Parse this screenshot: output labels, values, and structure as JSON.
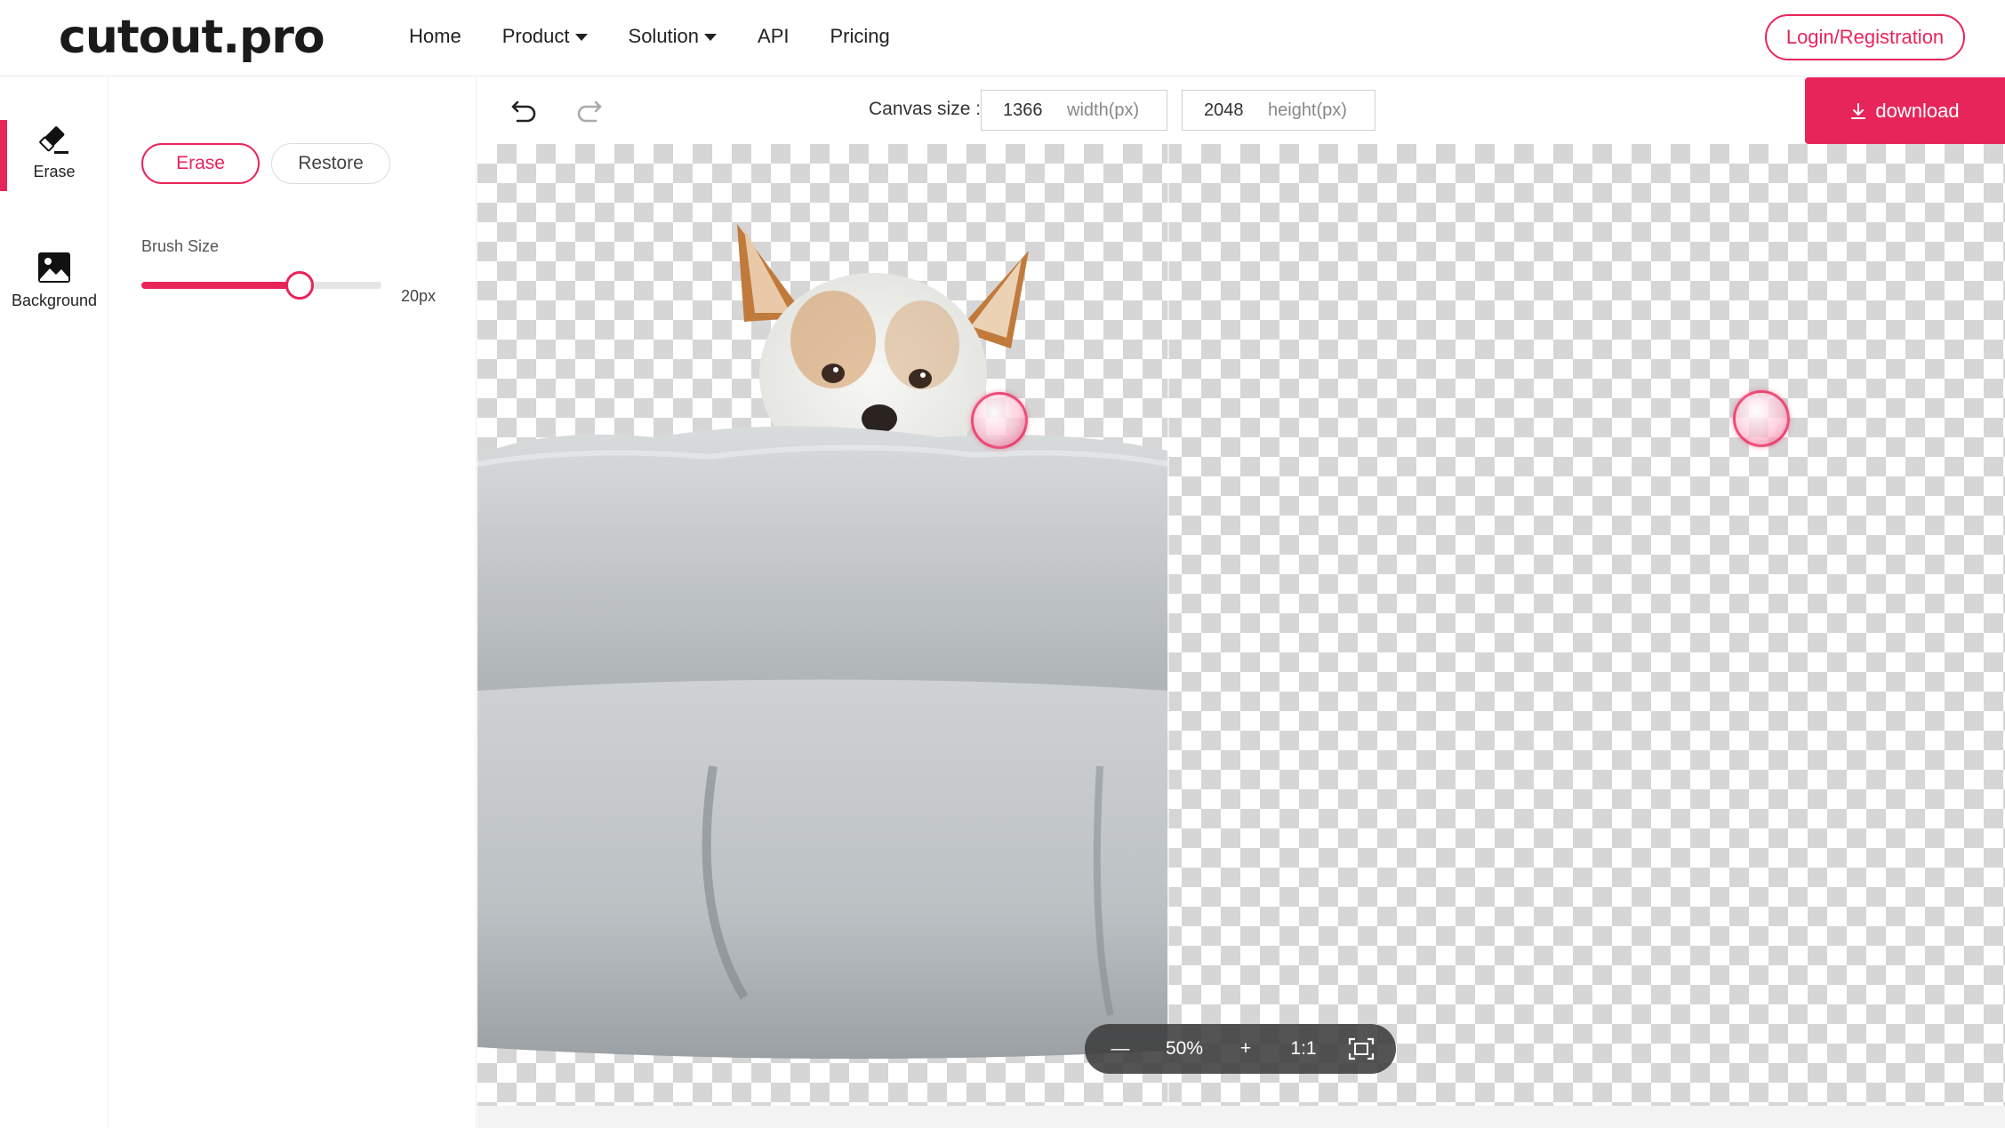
{
  "header": {
    "logo": "cutout.pro",
    "nav": [
      {
        "label": "Home",
        "has_dropdown": false
      },
      {
        "label": "Product",
        "has_dropdown": true
      },
      {
        "label": "Solution",
        "has_dropdown": true
      },
      {
        "label": "API",
        "has_dropdown": false
      },
      {
        "label": "Pricing",
        "has_dropdown": false
      }
    ],
    "login_label": "Login/Registration"
  },
  "rail": {
    "items": [
      {
        "label": "Erase",
        "icon": "eraser-icon",
        "active": true
      },
      {
        "label": "Background",
        "icon": "image-icon",
        "active": false
      }
    ]
  },
  "panel": {
    "modes": [
      {
        "label": "Erase",
        "active": true
      },
      {
        "label": "Restore",
        "active": false
      }
    ],
    "brush_label": "Brush Size",
    "brush_value": "20px",
    "brush_level": 0.66
  },
  "toolbar": {
    "undo_icon": "undo-icon",
    "redo_icon": "redo-icon",
    "canvas_label": "Canvas size :",
    "width_value": "1366",
    "width_unit": "width(px)",
    "height_value": "2048",
    "height_unit": "height(px)",
    "download_label": "download",
    "download_icon": "download-icon"
  },
  "zoom": {
    "minus": "—",
    "percent": "50%",
    "plus": "+",
    "ratio": "1:1",
    "fit_icon": "fit-screen-icon"
  },
  "colors": {
    "accent": "#e8255a",
    "checker": "#d6d6d6",
    "zoombar": "#3c3c3c"
  }
}
